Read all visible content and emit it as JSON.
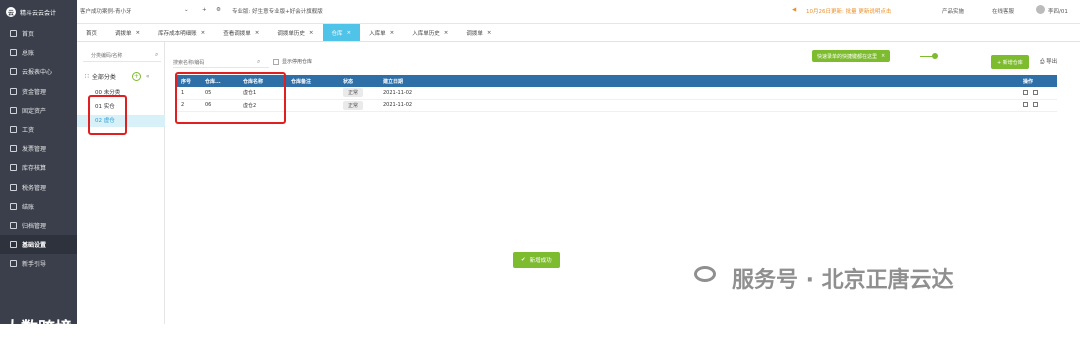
{
  "app": {
    "logo_text": "精斗云云会计"
  },
  "topbar": {
    "company": "客户成功案例-青小牙",
    "env": "专业版: 好生意专业版+好会计旗舰版",
    "notice": "10月26日更新: 批量 更新说明点击",
    "product": "产品实施",
    "support": "在线客服",
    "user": "李四/01"
  },
  "sidebar": {
    "items": [
      {
        "label": "首页",
        "icon": "home-icon"
      },
      {
        "label": "总账",
        "icon": "ledger-icon"
      },
      {
        "label": "云报表中心",
        "icon": "report-icon"
      },
      {
        "label": "资金管理",
        "icon": "money-icon"
      },
      {
        "label": "固定资产",
        "icon": "asset-icon"
      },
      {
        "label": "工资",
        "icon": "salary-icon"
      },
      {
        "label": "发票管理",
        "icon": "invoice-icon"
      },
      {
        "label": "库存核算",
        "icon": "inventory-icon"
      },
      {
        "label": "税务管理",
        "icon": "tax-icon"
      },
      {
        "label": "结账",
        "icon": "close-book-icon"
      },
      {
        "label": "归档管理",
        "icon": "archive-icon"
      },
      {
        "label": "基础设置",
        "icon": "settings-icon"
      },
      {
        "label": "新手引导",
        "icon": "guide-icon"
      }
    ],
    "bottom_logo": "大数跨境"
  },
  "tabs": [
    {
      "label": "首页",
      "closable": false
    },
    {
      "label": "调拨单",
      "closable": true
    },
    {
      "label": "库存成本明细账",
      "closable": true
    },
    {
      "label": "查看调拨单",
      "closable": true
    },
    {
      "label": "调拨单历史",
      "closable": true
    },
    {
      "label": "仓库",
      "closable": true,
      "active": true
    },
    {
      "label": "入库单",
      "closable": true
    },
    {
      "label": "入库单历史",
      "closable": true
    },
    {
      "label": "调拨单",
      "closable": true
    }
  ],
  "left_panel": {
    "search_placeholder": "分类编码/名称",
    "all_category": "全部分类",
    "items": [
      "00 未分类",
      "01 实仓",
      "02 虚仓"
    ]
  },
  "main": {
    "search_placeholder": "搜索名称/编码",
    "show_disabled": "显示停用仓库",
    "columns": [
      "序号",
      "仓库...",
      "仓库名称",
      "仓库备注",
      "状态",
      "建立日期",
      "操作"
    ],
    "rows": [
      {
        "no": "1",
        "code": "05",
        "name": "虚仓1",
        "remark": "",
        "status": "正常",
        "date": "2021-11-02"
      },
      {
        "no": "2",
        "code": "06",
        "name": "虚仓2",
        "remark": "",
        "status": "正常",
        "date": "2021-11-02"
      }
    ],
    "tip": "快速录单的快捷键都在这里",
    "new_button": "+ 新增仓库",
    "export_button": "导出"
  },
  "toast": "新增成功",
  "watermark": "服务号 · 北京正唐云达",
  "colors": {
    "sidebar": "#3a3f4b",
    "accent": "#4fc3e8",
    "green": "#7dbb2f",
    "header": "#2f6fa8",
    "highlight": "#e02020"
  }
}
